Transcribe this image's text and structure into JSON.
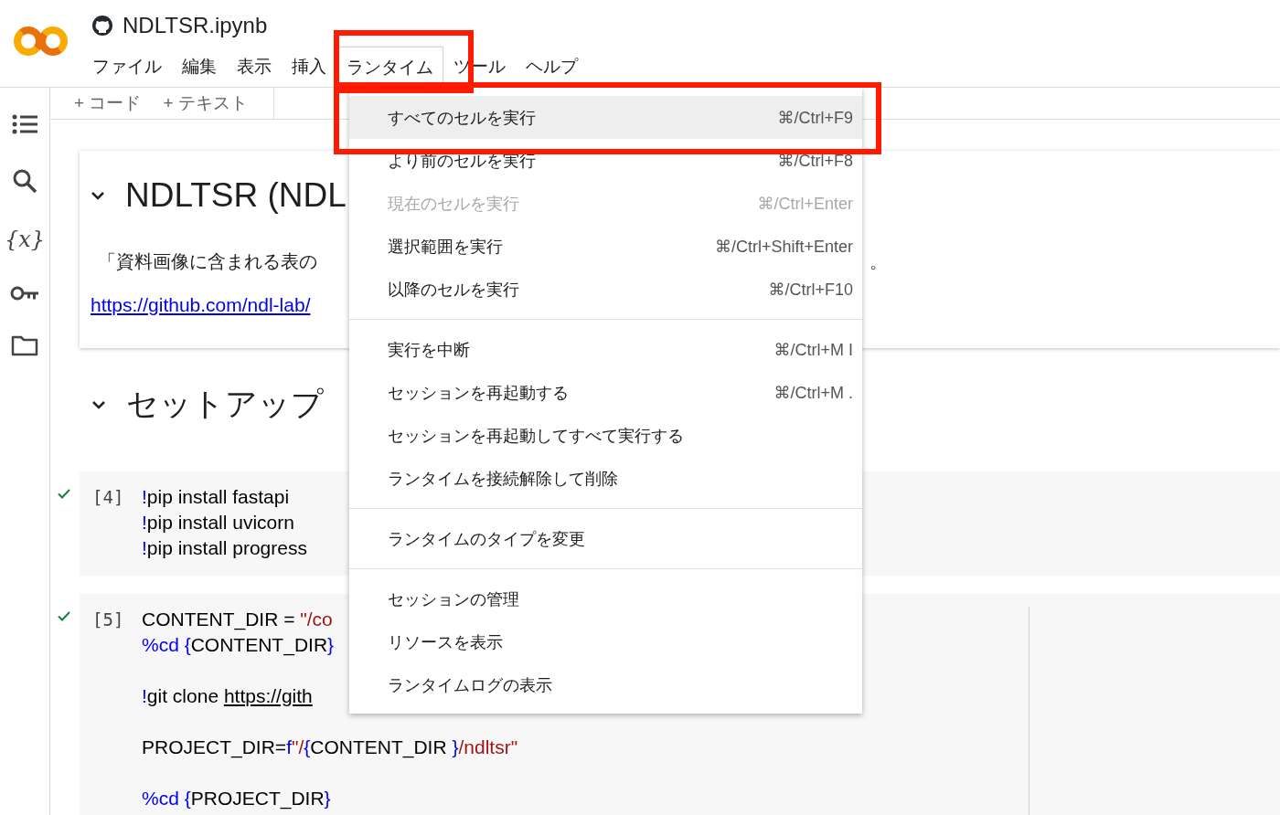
{
  "header": {
    "title": "NDLTSR.ipynb",
    "menubar": [
      {
        "label": "ファイル",
        "selected": false
      },
      {
        "label": "編集",
        "selected": false
      },
      {
        "label": "表示",
        "selected": false
      },
      {
        "label": "挿入",
        "selected": false
      },
      {
        "label": "ランタイム",
        "selected": true
      },
      {
        "label": "ツール",
        "selected": false
      },
      {
        "label": "ヘルプ",
        "selected": false
      }
    ]
  },
  "sidebar": {
    "items": [
      {
        "kind": "toc"
      },
      {
        "kind": "search"
      },
      {
        "kind": "variables",
        "glyph": "{x}"
      },
      {
        "kind": "secrets"
      },
      {
        "kind": "files"
      }
    ]
  },
  "toolbar": {
    "buttons": [
      {
        "label": "+ コード"
      },
      {
        "label": "+ テキスト"
      }
    ]
  },
  "notebook": {
    "text_cell": {
      "heading": "NDLTSR (NDL",
      "paragraph_start": "「資料画像に含まれる表の",
      "paragraph_end": "。",
      "link": "https://github.com/ndl-lab/"
    },
    "section": {
      "heading": "セットアップ",
      "expanded": true
    },
    "code_cells": [
      {
        "count": "[4]",
        "executed": true,
        "blocks": [
          [
            {
              "tokens": [
                {
                  "kind": "op",
                  "text": "!"
                },
                {
                  "kind": "plain",
                  "text": "pip install fastapi"
                }
              ]
            },
            {
              "tokens": [
                {
                  "kind": "op",
                  "text": "!"
                },
                {
                  "kind": "plain",
                  "text": "pip install uvicorn"
                }
              ]
            },
            {
              "tokens": [
                {
                  "kind": "op",
                  "text": "!"
                },
                {
                  "kind": "plain",
                  "text": "pip install progress"
                }
              ]
            }
          ]
        ]
      },
      {
        "count": "[5]",
        "executed": true,
        "blocks": [
          [
            {
              "tokens": [
                {
                  "kind": "plain",
                  "text": "CONTENT_DIR = "
                },
                {
                  "kind": "string",
                  "text": "\"/co"
                }
              ]
            },
            {
              "tokens": [
                {
                  "kind": "op",
                  "text": "%cd "
                },
                {
                  "kind": "op",
                  "text": "{"
                },
                {
                  "kind": "plain",
                  "text": "CONTENT_DIR"
                },
                {
                  "kind": "op",
                  "text": "}"
                }
              ]
            }
          ],
          [
            {
              "tokens": [
                {
                  "kind": "op",
                  "text": "!"
                },
                {
                  "kind": "plain",
                  "text": "git clone "
                },
                {
                  "kind": "link",
                  "text": "https://gith"
                }
              ]
            }
          ],
          [
            {
              "tokens": [
                {
                  "kind": "plain",
                  "text": "PROJECT_DIR="
                },
                {
                  "kind": "op",
                  "text": "f"
                },
                {
                  "kind": "string",
                  "text": "\"/"
                },
                {
                  "kind": "op",
                  "text": "{"
                },
                {
                  "kind": "plain",
                  "text": "CONTENT_DIR "
                },
                {
                  "kind": "op",
                  "text": "}"
                },
                {
                  "kind": "string",
                  "text": "/ndltsr\""
                }
              ]
            }
          ],
          [
            {
              "tokens": [
                {
                  "kind": "op",
                  "text": "%cd "
                },
                {
                  "kind": "op",
                  "text": "{"
                },
                {
                  "kind": "plain",
                  "text": "PROJECT_DIR"
                },
                {
                  "kind": "op",
                  "text": "}"
                }
              ]
            }
          ]
        ]
      }
    ]
  },
  "runtime_menu": {
    "groups": [
      [
        {
          "label": "すべてのセルを実行",
          "shortcut": "⌘/Ctrl+F9",
          "disabled": false,
          "selected": true
        },
        {
          "label": "より前のセルを実行",
          "shortcut": "⌘/Ctrl+F8",
          "disabled": false,
          "selected": false
        },
        {
          "label": "現在のセルを実行",
          "shortcut": "⌘/Ctrl+Enter",
          "disabled": true,
          "selected": false
        },
        {
          "label": "選択範囲を実行",
          "shortcut": "⌘/Ctrl+Shift+Enter",
          "disabled": false,
          "selected": false
        },
        {
          "label": "以降のセルを実行",
          "shortcut": "⌘/Ctrl+F10",
          "disabled": false,
          "selected": false
        }
      ],
      [
        {
          "label": "実行を中断",
          "shortcut": "⌘/Ctrl+M I",
          "disabled": false,
          "selected": false
        },
        {
          "label": "セッションを再起動する",
          "shortcut": "⌘/Ctrl+M .",
          "disabled": false,
          "selected": false
        },
        {
          "label": "セッションを再起動してすべて実行する",
          "disabled": false,
          "selected": false
        },
        {
          "label": "ランタイムを接続解除して削除",
          "disabled": false,
          "selected": false
        }
      ],
      [
        {
          "label": "ランタイムのタイプを変更",
          "disabled": false,
          "selected": false
        }
      ],
      [
        {
          "label": "セッションの管理",
          "disabled": false,
          "selected": false
        },
        {
          "label": "リソースを表示",
          "disabled": false,
          "selected": false
        },
        {
          "label": "ランタイムログの表示",
          "disabled": false,
          "selected": false
        }
      ]
    ]
  }
}
